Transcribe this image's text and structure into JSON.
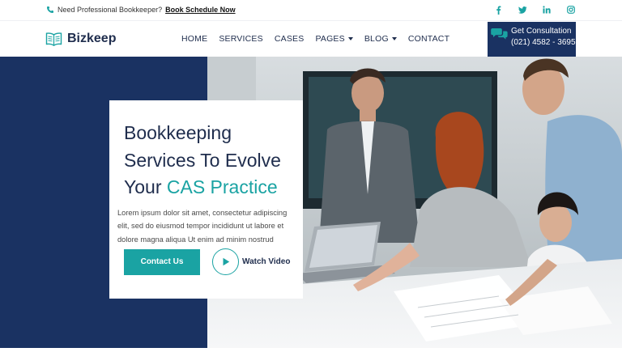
{
  "topbar": {
    "prompt_text": "Need Professional Bookkeeper?",
    "link_text": "Book Schedule Now",
    "socials": [
      "facebook-icon",
      "twitter-icon",
      "linkedin-icon",
      "instagram-icon"
    ]
  },
  "brand": {
    "name": "Bizkeep"
  },
  "nav": {
    "items": [
      {
        "label": "HOME",
        "has_dropdown": false
      },
      {
        "label": "SERVICES",
        "has_dropdown": false
      },
      {
        "label": "CASES",
        "has_dropdown": false
      },
      {
        "label": "PAGES",
        "has_dropdown": true
      },
      {
        "label": "BLOG",
        "has_dropdown": true
      },
      {
        "label": "CONTACT",
        "has_dropdown": false
      }
    ]
  },
  "consultation": {
    "title": "Get Consultation",
    "phone": "(021) 4582 - 3695"
  },
  "hero": {
    "headline_line1": "Bookkeeping",
    "headline_line2": "Services To Evolve",
    "headline_line3_prefix": "Your ",
    "headline_line3_accent": "CAS Practice",
    "description": "Lorem ipsum dolor sit amet, consectetur adipiscing elit, sed do eiusmod tempor incididunt ut labore et dolore magna aliqua Ut enim ad minim nostrud",
    "primary_button": "Contact Us",
    "video_button": "Watch Video"
  },
  "colors": {
    "navy": "#1a3262",
    "accent": "#1aa3a3",
    "white": "#ffffff"
  }
}
